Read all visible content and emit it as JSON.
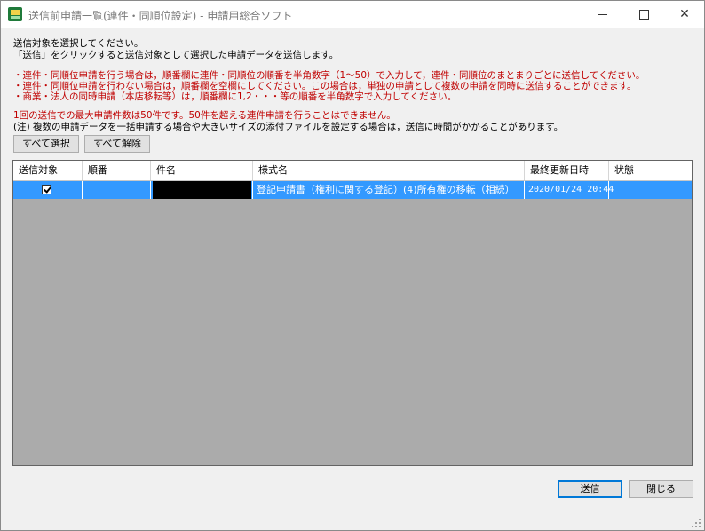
{
  "window": {
    "title": "送信前申請一覧(連件・同順位設定) - 申請用総合ソフト",
    "minimize_label": "—",
    "maximize_label": "☐",
    "close_label": "✕"
  },
  "instructions": {
    "line1": "送信対象を選択してください。",
    "line2": "「送信」をクリックすると送信対象として選択した申請データを送信します。",
    "notes": [
      "・連件・同順位申請を行う場合は，順番欄に連件・同順位の順番を半角数字（1～50）で入力して，連件・同順位のまとまりごとに送信してください。",
      "・連件・同順位申請を行わない場合は，順番欄を空欄にしてください。この場合は，単独の申請として複数の申請を同時に送信することができます。",
      "・商業・法人の同時申請（本店移転等）は，順番欄に1,2・・・等の順番を半角数字で入力してください。"
    ],
    "max_note": "1回の送信での最大申請件数は50件です。50件を超える連件申請を行うことはできません。",
    "caution": "(注) 複数の申請データを一括申請する場合や大きいサイズの添付ファイルを設定する場合は，送信に時間がかかることがあります。"
  },
  "toolbar": {
    "select_all_label": "すべて選択",
    "deselect_all_label": "すべて解除"
  },
  "table": {
    "columns": [
      "送信対象",
      "順番",
      "件名",
      "様式名",
      "最終更新日時",
      "状態"
    ],
    "rows": [
      {
        "selected": true,
        "order": "",
        "subject": "",
        "form_name": "登記申請書（権利に関する登記）(4)所有権の移転（相続）",
        "updated": "2020/01/24 20:44",
        "status": ""
      }
    ]
  },
  "footer": {
    "send_label": "送信",
    "close_label": "閉じる"
  },
  "colors": {
    "selection": "#3399ff",
    "notice_red": "#c00000",
    "grid_background": "#ababab"
  }
}
